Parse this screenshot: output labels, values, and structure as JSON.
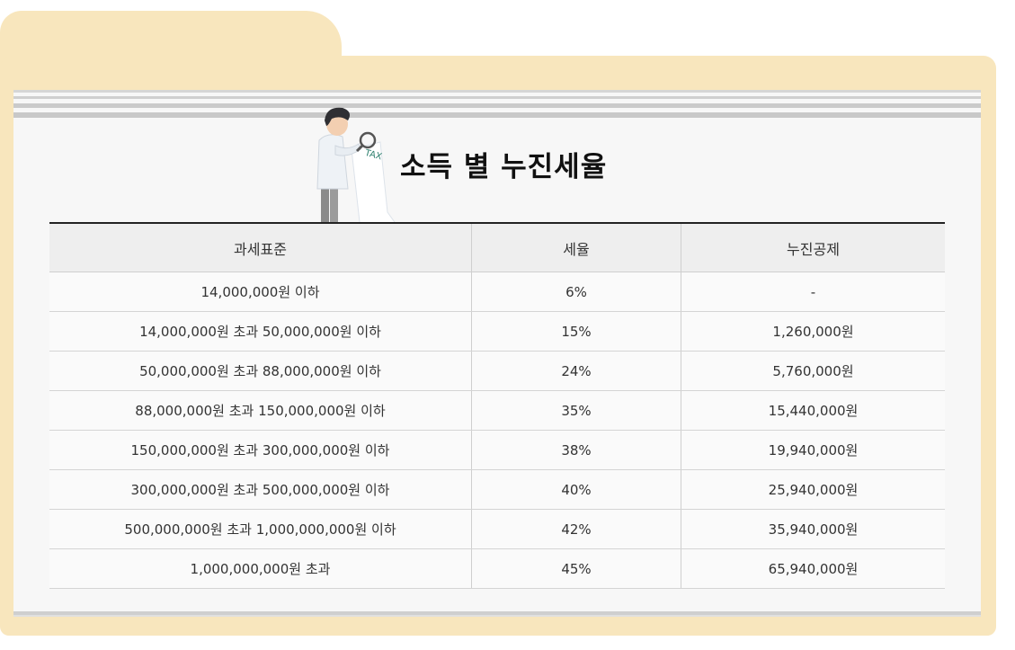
{
  "title": "소득 별 누진세율",
  "illustration": {
    "icon": "man-with-magnifier-tax-icon",
    "label": "TAX"
  },
  "table": {
    "headers": [
      "과세표준",
      "세율",
      "누진공제"
    ],
    "rows": [
      [
        "14,000,000원 이하",
        "6%",
        "-"
      ],
      [
        "14,000,000원 초과 50,000,000원 이하",
        "15%",
        "1,260,000원"
      ],
      [
        "50,000,000원 초과 88,000,000원 이하",
        "24%",
        "5,760,000원"
      ],
      [
        "88,000,000원 초과 150,000,000원 이하",
        "35%",
        "15,440,000원"
      ],
      [
        "150,000,000원 초과 300,000,000원 이하",
        "38%",
        "19,940,000원"
      ],
      [
        "300,000,000원 초과 500,000,000원 이하",
        "40%",
        "25,940,000원"
      ],
      [
        "500,000,000원 초과 1,000,000,000원 이하",
        "42%",
        "35,940,000원"
      ],
      [
        "1,000,000,000원 초과",
        "45%",
        "65,940,000원"
      ]
    ]
  },
  "colors": {
    "folder": "#f8e6bd",
    "paper": "#f7f7f7",
    "header_bg": "#eeeeee",
    "header_border": "#222222"
  }
}
